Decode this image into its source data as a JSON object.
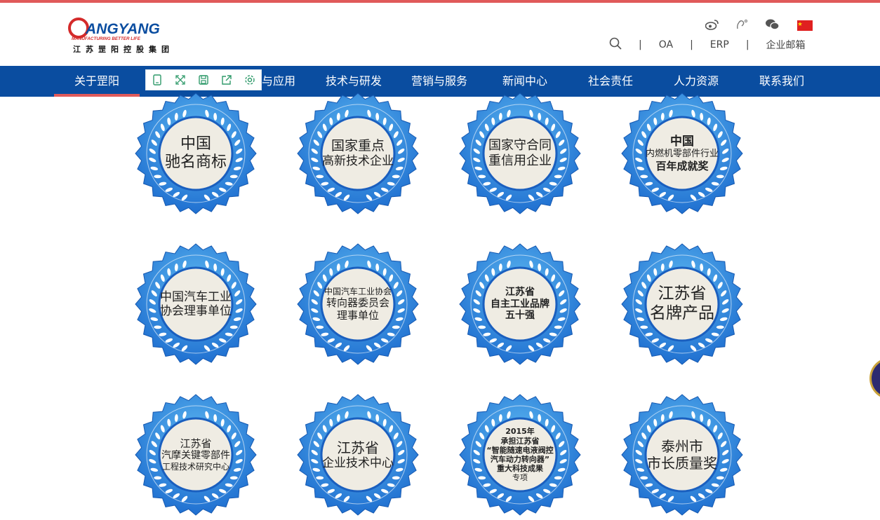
{
  "brand": {
    "name": "ANGYANG",
    "tagline": "MANUFACTURING BETTER LIFE",
    "company_cn": "江苏罡阳控股集团"
  },
  "header": {
    "social_icons": [
      "weibo-icon",
      "ear-icon",
      "wechat-icon"
    ],
    "flag": "cn-flag-icon",
    "links": [
      "OA",
      "ERP",
      "企业邮箱"
    ]
  },
  "nav": {
    "items": [
      "关于罡阳",
      "产品与应用",
      "技术与研发",
      "营销与服务",
      "新闻中心",
      "社会责任",
      "人力资源",
      "联系我们"
    ],
    "visible_labels": [
      "关于罡阳",
      "与应用",
      "技术与研发",
      "营销与服务",
      "新闻中心",
      "社会责任",
      "人力资源",
      "联系我们"
    ],
    "active": "关于罡阳"
  },
  "toolbar": {
    "icons": [
      "tablet-icon",
      "expand-icon",
      "save-icon",
      "share-icon",
      "gear-icon"
    ]
  },
  "colors": {
    "nav_bg": "#0a4da0",
    "accent_red": "#e05a5a",
    "badge_blue": "#1f6fd0",
    "badge_light": "#5ab5f0",
    "badge_center": "#efece3"
  },
  "badges": [
    {
      "lines": [
        "中国",
        "驰名商标"
      ]
    },
    {
      "lines": [
        "国家重点",
        "高新技术企业"
      ]
    },
    {
      "lines": [
        "国家守合同",
        "重信用企业"
      ]
    },
    {
      "lines": [
        "中国",
        "内燃机零部件行业",
        "百年成就奖"
      ]
    },
    {
      "lines": [
        "中国汽车工业",
        "协会理事单位"
      ]
    },
    {
      "lines": [
        "中国汽车工业协会",
        "转向器委员会",
        "理事单位"
      ]
    },
    {
      "lines": [
        "江苏省",
        "自主工业品牌",
        "五十强"
      ]
    },
    {
      "lines": [
        "江苏省",
        "名牌产品"
      ]
    },
    {
      "lines": [
        "江苏省",
        "汽摩关键零部件",
        "工程技术研究中心"
      ]
    },
    {
      "lines": [
        "江苏省",
        "企业技术中心"
      ]
    },
    {
      "lines": [
        "2015年",
        "承担江苏省",
        "“智能随速电液阀控",
        "汽车动力转向器”",
        "重大科技成果",
        "专项"
      ]
    },
    {
      "lines": [
        "泰州市",
        "市长质量奖"
      ]
    }
  ]
}
